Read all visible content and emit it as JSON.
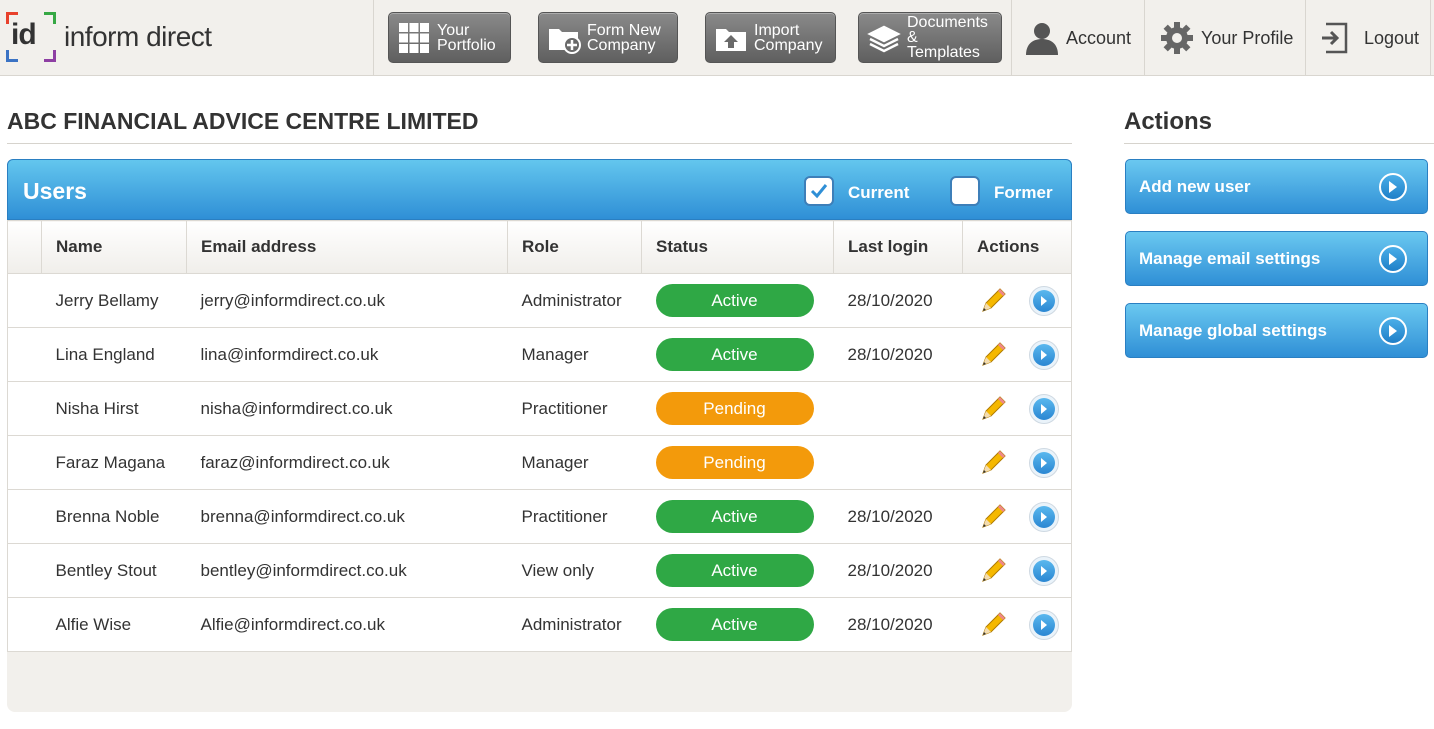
{
  "header": {
    "logo_mark": "id",
    "logo_name": "inform direct",
    "nav": [
      {
        "label": "Your Portfolio",
        "icon": "grid-icon"
      },
      {
        "label": "Form New Company",
        "icon": "folder-add-icon"
      },
      {
        "label": "Import Company",
        "icon": "folder-import-icon"
      },
      {
        "label": "Documents & Templates",
        "icon": "documents-stack-icon"
      }
    ],
    "account_label": "Account",
    "profile_label": "Your Profile",
    "logout_label": "Logout"
  },
  "page": {
    "title": "ABC FINANCIAL ADVICE CENTRE LIMITED"
  },
  "users_panel": {
    "heading": "Users",
    "filter_current": {
      "label": "Current",
      "checked": true
    },
    "filter_former": {
      "label": "Former",
      "checked": false
    },
    "columns": [
      "Name",
      "Email address",
      "Role",
      "Status",
      "Last login",
      "Actions"
    ],
    "rows": [
      {
        "name": "Jerry Bellamy",
        "email": "jerry@informdirect.co.uk",
        "role": "Administrator",
        "status": "Active",
        "last_login": "28/10/2020"
      },
      {
        "name": "Lina England",
        "email": "lina@informdirect.co.uk",
        "role": "Manager",
        "status": "Active",
        "last_login": "28/10/2020"
      },
      {
        "name": "Nisha Hirst",
        "email": "nisha@informdirect.co.uk",
        "role": "Practitioner",
        "status": "Pending",
        "last_login": ""
      },
      {
        "name": "Faraz Magana",
        "email": "faraz@informdirect.co.uk",
        "role": "Manager",
        "status": "Pending",
        "last_login": ""
      },
      {
        "name": "Brenna Noble",
        "email": "brenna@informdirect.co.uk",
        "role": "Practitioner",
        "status": "Active",
        "last_login": "28/10/2020"
      },
      {
        "name": "Bentley Stout",
        "email": "bentley@informdirect.co.uk",
        "role": "View only",
        "status": "Active",
        "last_login": "28/10/2020"
      },
      {
        "name": "Alfie Wise",
        "email": "Alfie@informdirect.co.uk",
        "role": "Administrator",
        "status": "Active",
        "last_login": "28/10/2020"
      }
    ]
  },
  "actions": {
    "title": "Actions",
    "buttons": [
      "Add new user",
      "Manage email settings",
      "Manage global settings"
    ]
  },
  "colors": {
    "active": "#2fa845",
    "pending": "#f39a0b",
    "accent_blue": "#2f8fd6"
  }
}
